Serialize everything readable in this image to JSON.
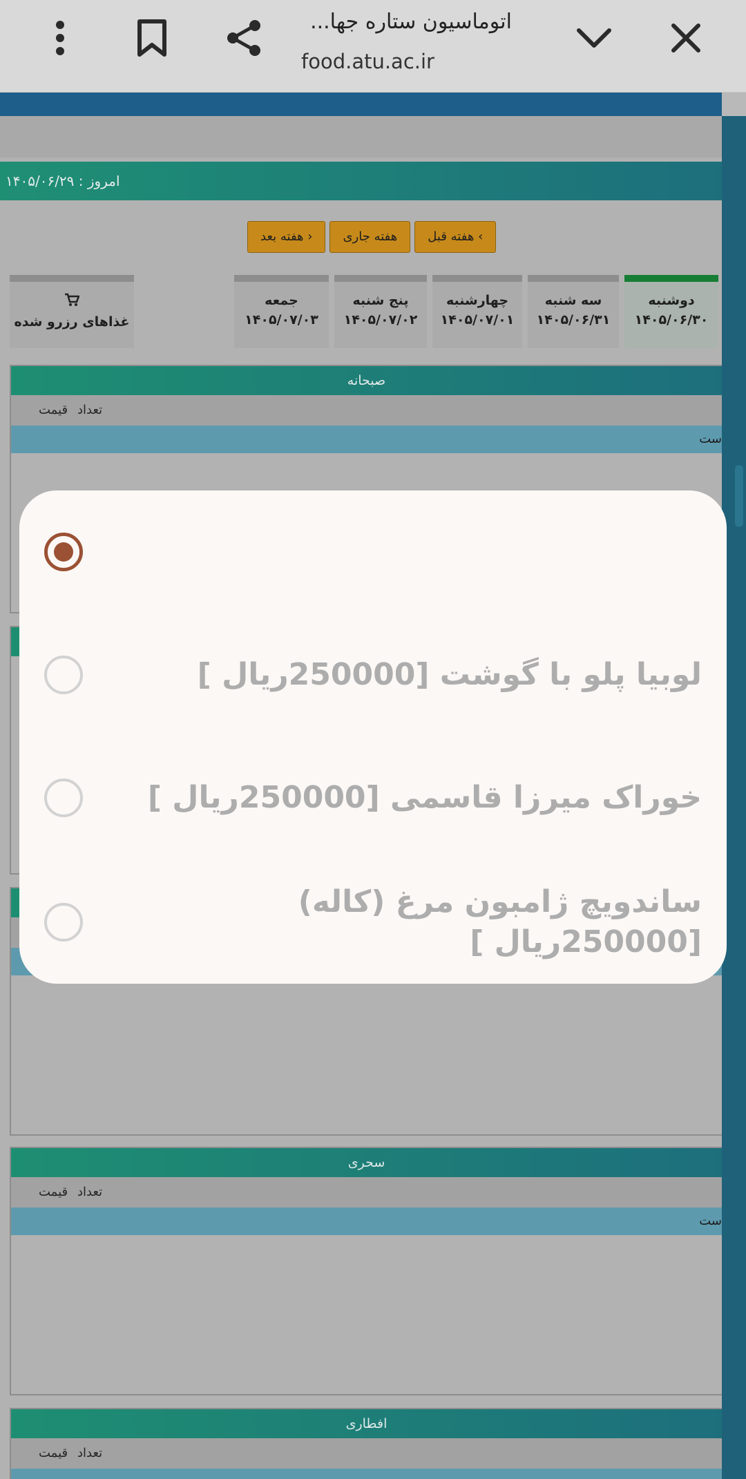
{
  "browser": {
    "title": "اتوماسیون ستاره جها...",
    "url": "food.atu.ac.ir"
  },
  "page": {
    "today": "امروز : ۱۴۰۵/۰۶/۲۹",
    "week_buttons": {
      "prev": "هفته قبل",
      "current": "هفته جاری",
      "next": "هفته بعد"
    },
    "days": [
      {
        "name": "دوشنبه",
        "date": "۱۴۰۵/۰۶/۳۰",
        "active": true
      },
      {
        "name": "سه شنبه",
        "date": "۱۴۰۵/۰۶/۳۱",
        "active": false
      },
      {
        "name": "چهارشنبه",
        "date": "۱۴۰۵/۰۷/۰۱",
        "active": false
      },
      {
        "name": "پنج شنبه",
        "date": "۱۴۰۵/۰۷/۰۲",
        "active": false
      },
      {
        "name": "جمعه",
        "date": "۱۴۰۵/۰۷/۰۳",
        "active": false
      }
    ],
    "reserved_tab": "غذاهای رزرو شده",
    "columns": {
      "count": "تعداد",
      "price": "قیمت"
    },
    "row_fragment": "ست",
    "sections": [
      "صبحانه",
      "سحری",
      "افطاری"
    ]
  },
  "dialog": {
    "selected_index": 0,
    "options": [
      "",
      "لوبیا پلو با گوشت [250000ریال ]",
      "خوراک میرزا قاسمی [250000ریال ]",
      "ساندویچ ژامبون مرغ (کاله) [250000ریال ]"
    ]
  },
  "colors": {
    "accent": "#9b5134",
    "dialog_bg": "#fcf8f5",
    "header_teal": "#1e8e72",
    "button_gold": "#c78a1a"
  }
}
